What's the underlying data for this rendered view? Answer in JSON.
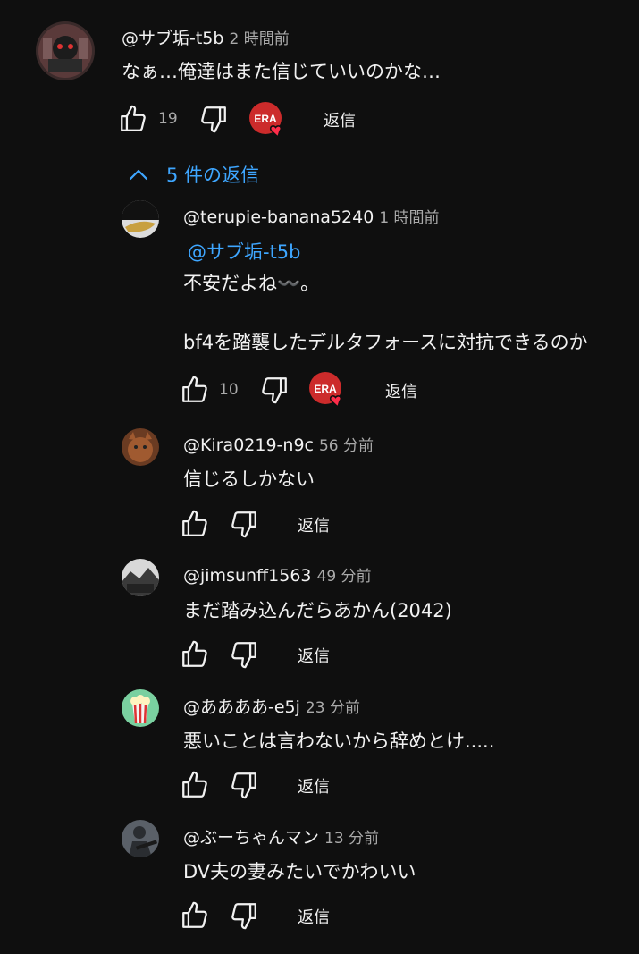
{
  "top_comment": {
    "handle": "@サブ垢-t5b",
    "time": "2 時間前",
    "text": "なぁ…俺達はまた信じていいのかな…",
    "likes": "19",
    "reply_label": "返信",
    "creator_badge_text": "ERA"
  },
  "replies_toggle": {
    "label": "5 件の返信"
  },
  "replies": [
    {
      "handle": "@terupie-banana5240",
      "time": "1 時間前",
      "mention": "@サブ垢-t5b",
      "line1": "不安だよね〰️。",
      "line2": "bf4を踏襲したデルタフォースに対抗できるのか",
      "likes": "10",
      "reply_label": "返信",
      "creator_badge_text": "ERA"
    },
    {
      "handle": "@Kira0219-n9c",
      "time": "56 分前",
      "text": "信じるしかない",
      "reply_label": "返信"
    },
    {
      "handle": "@jimsunff1563",
      "time": "49 分前",
      "text": "まだ踏み込んだらあかん(2042)",
      "reply_label": "返信"
    },
    {
      "handle": "@ああああ-e5j",
      "time": "23 分前",
      "text": "悪いことは言わないから辞めとけ.....",
      "reply_label": "返信"
    },
    {
      "handle": "@ぶーちゃんマン",
      "time": "13 分前",
      "text": "DV夫の妻みたいでかわいい",
      "reply_label": "返信"
    }
  ],
  "colors": {
    "background": "#0f0f0f",
    "text": "#f1f1f1",
    "muted": "#aaaaaa",
    "link": "#3ea6ff",
    "badge_red": "#cc2b2b"
  },
  "icons": [
    "thumb-up-icon",
    "thumb-down-icon",
    "heart-icon",
    "chevron-up-icon"
  ]
}
